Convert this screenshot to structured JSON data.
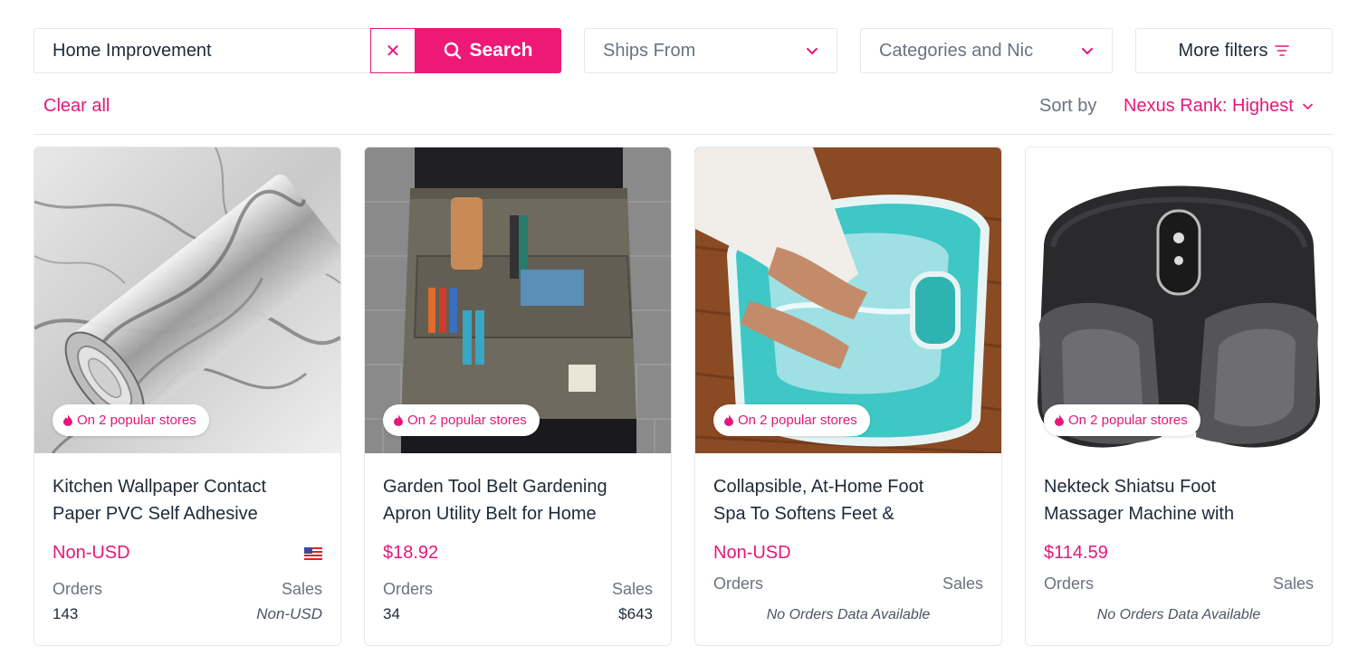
{
  "search": {
    "value": "Home Improvement",
    "clear_icon": "close-icon",
    "button_label": "Search",
    "button_icon": "search-icon"
  },
  "filters": {
    "ships_from": "Ships From",
    "categories": "Categories and Nic",
    "more_filters": "More filters"
  },
  "toolbar": {
    "clear_all": "Clear all",
    "sort_label": "Sort by",
    "sort_value": "Nexus Rank: Highest"
  },
  "colors": {
    "accent": "#ee1877",
    "muted": "#6b7280",
    "border": "#e5e7eb"
  },
  "products": [
    {
      "badge": "On 2 popular stores",
      "title_line1": "Kitchen Wallpaper Contact",
      "title_line2": "Paper PVC Self Adhesive",
      "price": "Non-USD",
      "flag": "us-flag-icon",
      "orders_label": "Orders",
      "sales_label": "Sales",
      "orders": "143",
      "sales": "Non-USD"
    },
    {
      "badge": "On 2 popular stores",
      "title_line1": "Garden Tool Belt Gardening",
      "title_line2": "Apron Utility Belt for Home",
      "price": "$18.92",
      "orders_label": "Orders",
      "sales_label": "Sales",
      "orders": "34",
      "sales": "$643"
    },
    {
      "badge": "On 2 popular stores",
      "title_line1": "Collapsible, At-Home Foot",
      "title_line2": "Spa To Softens Feet &",
      "price": "Non-USD",
      "orders_label": "Orders",
      "sales_label": "Sales",
      "no_data": "No Orders Data Available"
    },
    {
      "badge": "On 2 popular stores",
      "title_line1": "Nekteck Shiatsu Foot",
      "title_line2": "Massager Machine with",
      "price": "$114.59",
      "orders_label": "Orders",
      "sales_label": "Sales",
      "no_data": "No Orders Data Available"
    }
  ]
}
